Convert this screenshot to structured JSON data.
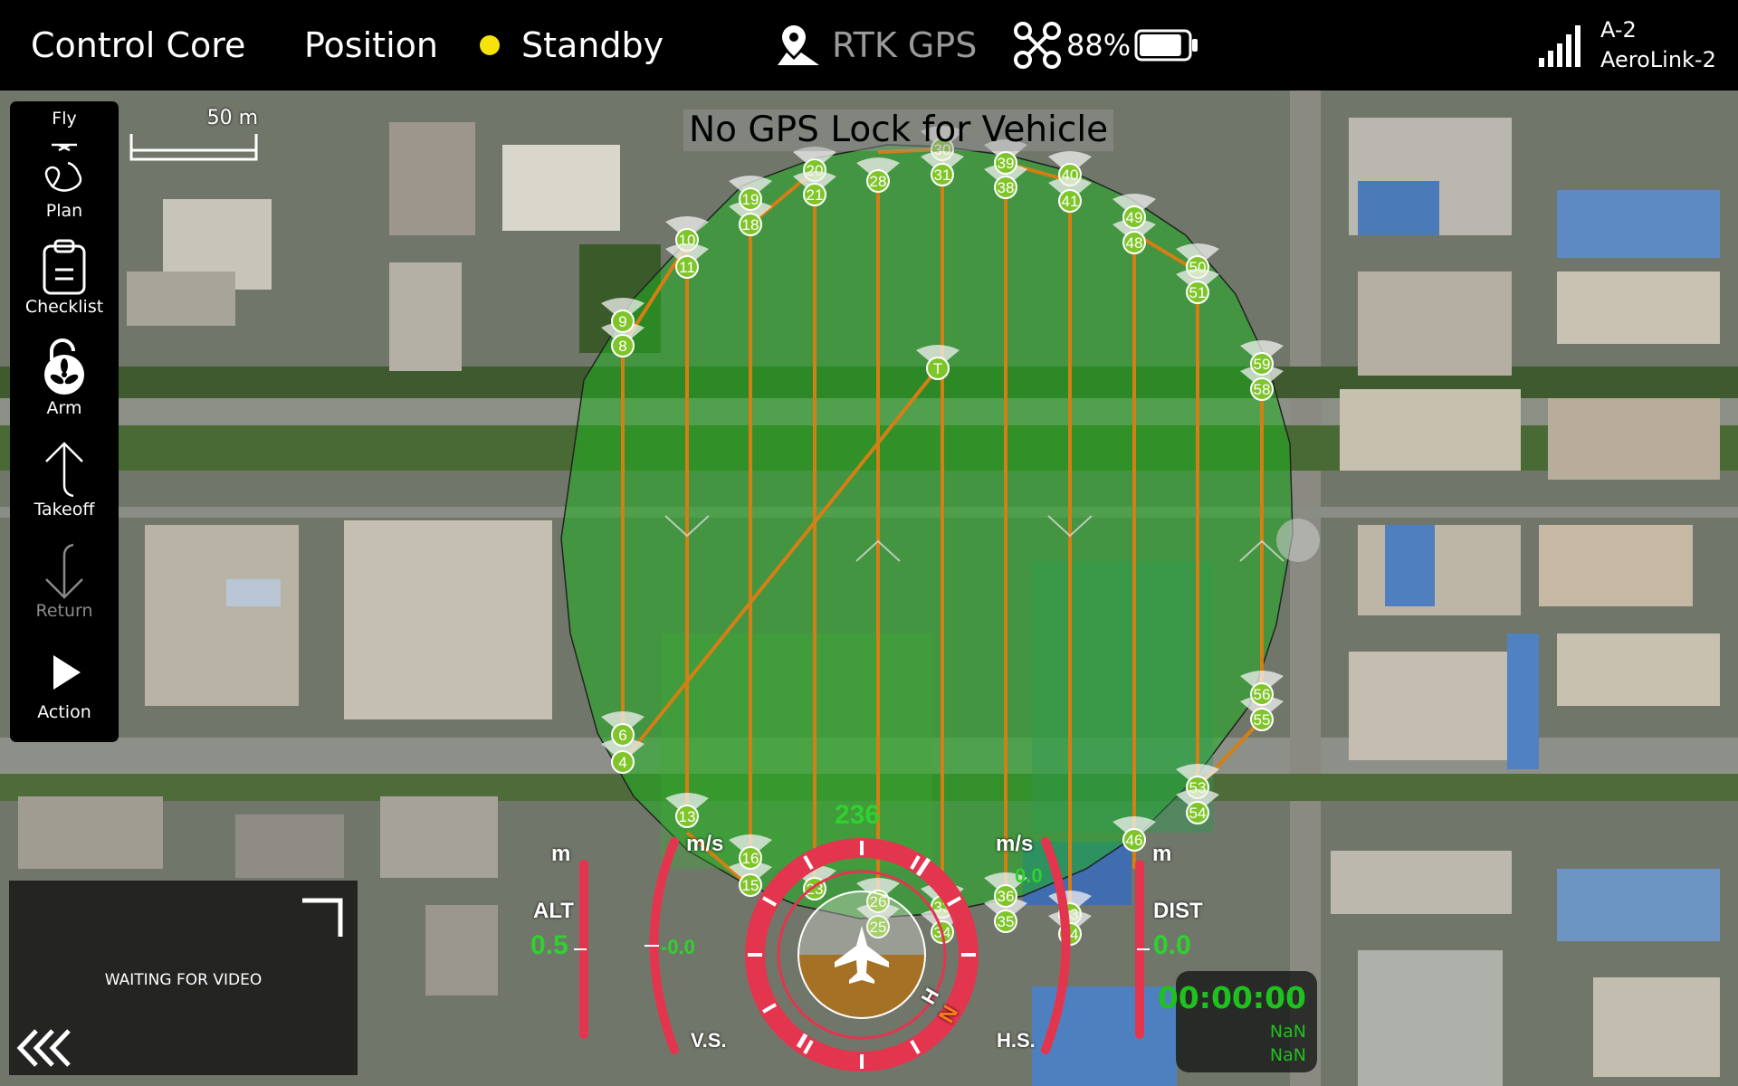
{
  "app": {
    "title": "Control Core",
    "flight_mode": "Position",
    "arm_status": "Standby",
    "arm_status_color": "#f5e30b",
    "gps_label": "RTK GPS",
    "battery_percent": "88%",
    "battery_level": 0.88,
    "link_id": "A-2",
    "link_name": "AeroLink-2"
  },
  "toolbar": {
    "items": [
      {
        "label": "Fly",
        "icon": "drone-icon"
      },
      {
        "label": "Plan",
        "icon": "plan-route-icon"
      },
      {
        "label": "Checklist",
        "icon": "clipboard-icon"
      },
      {
        "label": "Arm",
        "icon": "unlock-icon"
      },
      {
        "label": "Takeoff",
        "icon": "takeoff-arrow-icon"
      },
      {
        "label": "Return",
        "icon": "return-arrow-icon"
      },
      {
        "label": "Action",
        "icon": "play-icon"
      }
    ]
  },
  "map": {
    "scale_label": "50 m",
    "banner": "No GPS Lock for Vehicle",
    "survey_color": "#1fae1f",
    "path_color": "#d27f16",
    "waypoint_labels": [
      "4",
      "6",
      "8",
      "9",
      "10",
      "11",
      "13",
      "15",
      "16",
      "18",
      "19",
      "20",
      "21",
      "23",
      "25",
      "26",
      "28",
      "30",
      "31",
      "33",
      "34",
      "35",
      "36",
      "38",
      "39",
      "40",
      "41",
      "43",
      "44",
      "46",
      "48",
      "49",
      "50",
      "51",
      "53",
      "54",
      "55",
      "56",
      "58",
      "59",
      "T"
    ]
  },
  "video": {
    "status": "WAITING FOR VIDEO"
  },
  "hud": {
    "alt_unit": "m",
    "alt_label": "ALT",
    "alt_value": "0.5",
    "vs_unit": "m/s",
    "vs_value": "-0.0",
    "vs_label": "V.S.",
    "heading": "236",
    "hs_unit": "m/s",
    "hs_value": "0.0",
    "hs_label": "H.S.",
    "dist_unit": "m",
    "dist_label": "DIST",
    "dist_value": "0.0",
    "compass_h": "H",
    "compass_n": "N"
  },
  "timer": {
    "time": "00:00:00",
    "line1": "NaN",
    "line2": "NaN"
  }
}
